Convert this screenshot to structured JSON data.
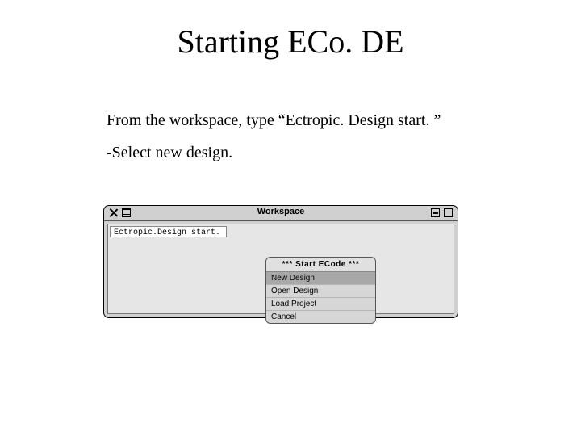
{
  "title": "Starting ECo. DE",
  "body": {
    "line1": "From the workspace, type “Ectropic. Design start. ”",
    "line2": "-Select new design."
  },
  "workspace": {
    "window_title": "Workspace",
    "command": "Ectropic.Design start."
  },
  "menu": {
    "header": "***  Start ECode  ***",
    "items": [
      {
        "label": "New Design",
        "selected": true
      },
      {
        "label": "Open Design",
        "selected": false
      },
      {
        "label": "Load Project",
        "selected": false
      },
      {
        "label": "Cancel",
        "selected": false
      }
    ]
  }
}
